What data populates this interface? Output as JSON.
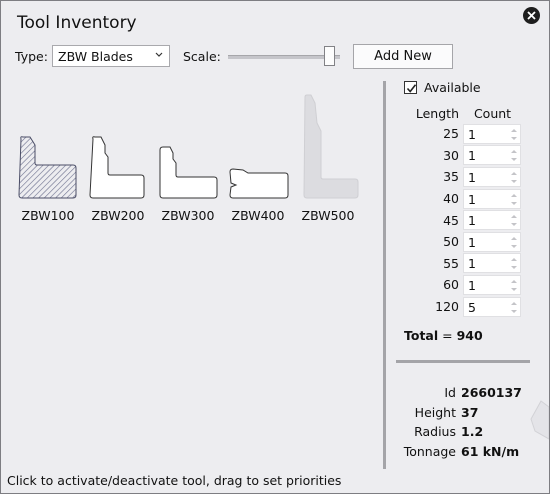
{
  "window": {
    "title": "Tool Inventory"
  },
  "toolbar": {
    "type_label": "Type:",
    "type_value": "ZBW Blades",
    "scale_label": "Scale:",
    "scale_level": 0.95,
    "add_button": "Add New"
  },
  "tools": [
    {
      "name": "ZBW100",
      "state": "selected"
    },
    {
      "name": "ZBW200",
      "state": "active"
    },
    {
      "name": "ZBW300",
      "state": "active"
    },
    {
      "name": "ZBW400",
      "state": "active"
    },
    {
      "name": "ZBW500",
      "state": "inactive"
    }
  ],
  "panel": {
    "available_label": "Available",
    "available_checked": true,
    "columns": [
      "Length",
      "Count"
    ],
    "rows": [
      {
        "length": "25",
        "count": "1"
      },
      {
        "length": "30",
        "count": "1"
      },
      {
        "length": "35",
        "count": "1"
      },
      {
        "length": "40",
        "count": "1"
      },
      {
        "length": "45",
        "count": "1"
      },
      {
        "length": "50",
        "count": "1"
      },
      {
        "length": "55",
        "count": "1"
      },
      {
        "length": "60",
        "count": "1"
      },
      {
        "length": "120",
        "count": "5"
      }
    ],
    "total_label": "Total",
    "total_value": "940"
  },
  "properties": [
    {
      "key": "Id",
      "value": "2660137"
    },
    {
      "key": "Height",
      "value": "37"
    },
    {
      "key": "Radius",
      "value": "1.2"
    },
    {
      "key": "Tonnage",
      "value": "61 kN/m"
    }
  ],
  "status": "Click to activate/deactivate tool, drag to set priorities",
  "colors": {
    "background": "#ededf0",
    "tool_inactive": "#dcdce0",
    "selected_hatch": "#6a6e8c"
  }
}
